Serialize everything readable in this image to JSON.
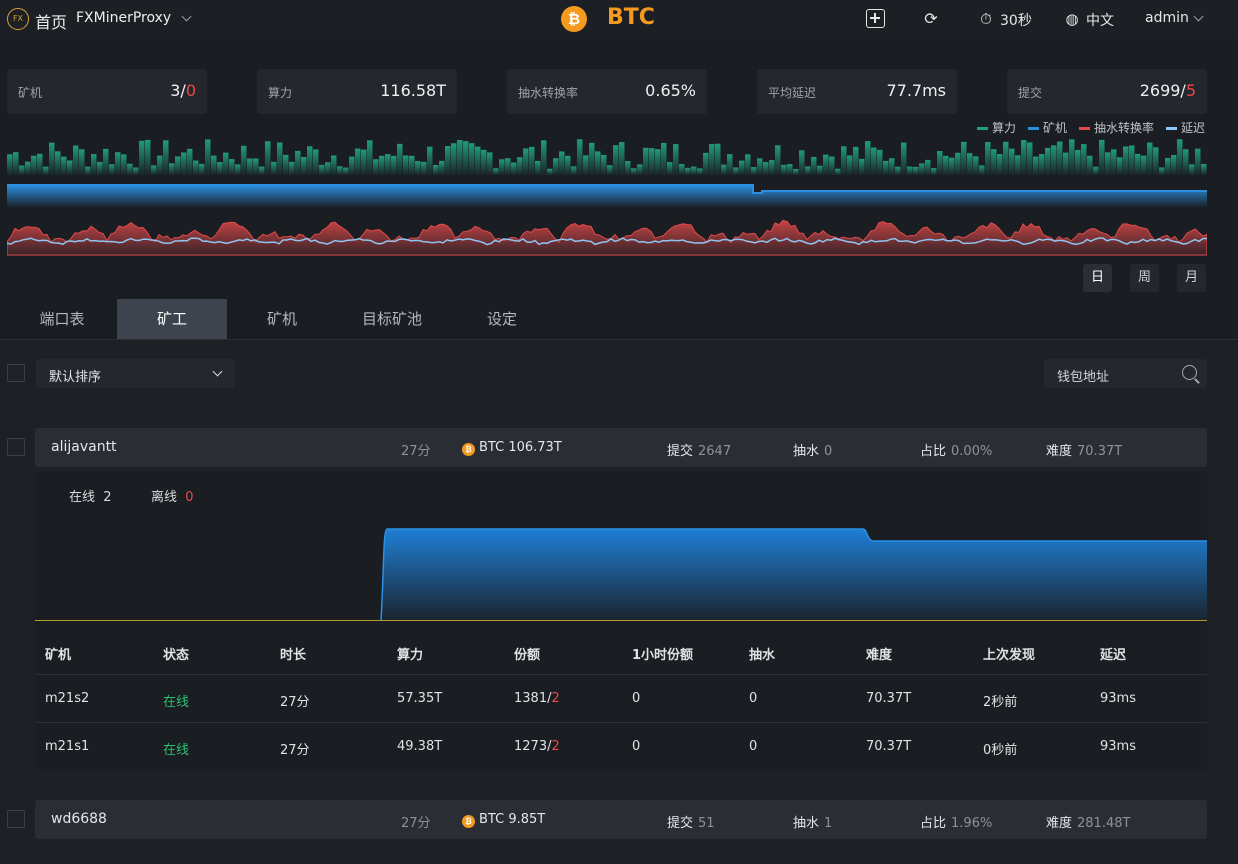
{
  "topbar": {
    "logo_text": "FX",
    "home": "首页",
    "app_name": "FXMinerProxy",
    "coin": "BTC",
    "refresh_interval": "30秒",
    "language": "中文",
    "user": "admin"
  },
  "stats": [
    {
      "label": "矿机",
      "value": "3/",
      "value_red": "0"
    },
    {
      "label": "算力",
      "value": "116.58T",
      "value_red": ""
    },
    {
      "label": "抽水转换率",
      "value": "0.65%",
      "value_red": ""
    },
    {
      "label": "平均延迟",
      "value": "77.7ms",
      "value_red": ""
    },
    {
      "label": "提交",
      "value": "2699/",
      "value_red": "5"
    }
  ],
  "legend": [
    {
      "label": "算力",
      "color": "#1fa37f"
    },
    {
      "label": "矿机",
      "color": "#2b8fe0"
    },
    {
      "label": "抽水转换率",
      "color": "#e24a4a"
    },
    {
      "label": "延迟",
      "color": "#8fc5f2"
    }
  ],
  "periods": [
    "日",
    "周",
    "月"
  ],
  "tabs": [
    "端口表",
    "矿工",
    "矿机",
    "目标矿池",
    "设定"
  ],
  "active_tab": 1,
  "sort_select": {
    "value": "默认排序"
  },
  "search": {
    "placeholder": "钱包地址"
  },
  "workers": [
    {
      "name": "alijavantt",
      "duration": "27分",
      "coin": "BTC",
      "hashrate": "106.73T",
      "submit_label": "提交",
      "submit": "2647",
      "fee_label": "抽水",
      "fee": "0",
      "ratio_label": "占比",
      "ratio": "0.00%",
      "diff_label": "难度",
      "diff": "70.37T"
    },
    {
      "name": "wd6688",
      "duration": "27分",
      "coin": "BTC",
      "hashrate": "9.85T",
      "submit_label": "提交",
      "submit": "51",
      "fee_label": "抽水",
      "fee": "1",
      "ratio_label": "占比",
      "ratio": "1.96%",
      "diff_label": "难度",
      "diff": "281.48T"
    }
  ],
  "detail": {
    "online_label": "在线",
    "online": "2",
    "offline_label": "离线",
    "offline": "0"
  },
  "table": {
    "headers": [
      "矿机",
      "状态",
      "时长",
      "算力",
      "份额",
      "1小时份额",
      "抽水",
      "难度",
      "上次发现",
      "延迟"
    ],
    "rows": [
      [
        "m21s2",
        "在线",
        "27分",
        "57.35T",
        "1381/",
        "0",
        "0",
        "70.37T",
        "2秒前",
        "93ms"
      ],
      [
        "m21s1",
        "在线",
        "27分",
        "49.38T",
        "1273/",
        "0",
        "0",
        "70.37T",
        "0秒前",
        "93ms"
      ]
    ],
    "rows_red": [
      "2",
      "2"
    ]
  }
}
